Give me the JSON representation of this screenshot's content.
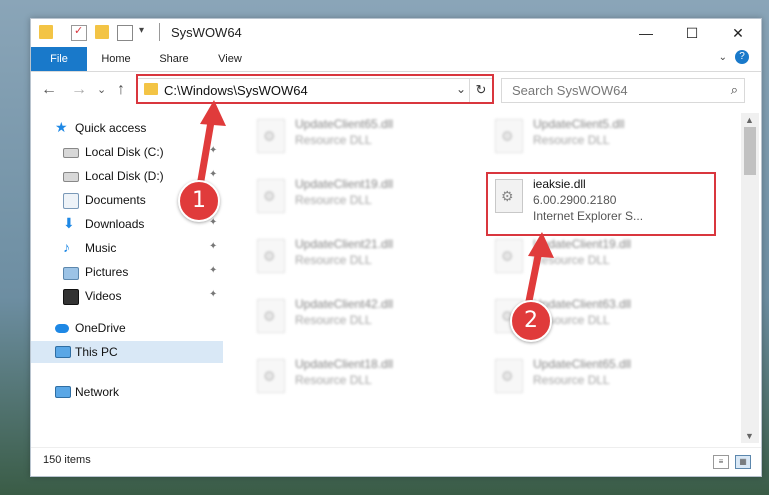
{
  "window": {
    "title": "SysWOW64",
    "minimize": "—",
    "maximize": "☐",
    "close": "✕"
  },
  "ribbon": {
    "tabs": [
      {
        "label": "File"
      },
      {
        "label": "Home"
      },
      {
        "label": "Share"
      },
      {
        "label": "View"
      }
    ],
    "collapse_glyph": "⌄",
    "help_glyph": "?"
  },
  "navigation": {
    "back_glyph": "←",
    "forward_glyph": "→",
    "recent_glyph": "⌄",
    "up_glyph": "↑",
    "address": "C:\\Windows\\SysWOW64",
    "address_dropdown_glyph": "⌄",
    "refresh_glyph": "↻",
    "search_placeholder": "Search SysWOW64",
    "search_glyph": "⌕"
  },
  "sidebar": {
    "items": [
      {
        "label": "Quick access",
        "icon": "star-icon"
      },
      {
        "label": "Local Disk (C:)",
        "icon": "drive-icon"
      },
      {
        "label": "Local Disk (D:)",
        "icon": "drive-icon"
      },
      {
        "label": "Documents",
        "icon": "documents-icon"
      },
      {
        "label": "Downloads",
        "icon": "downloads-icon"
      },
      {
        "label": "Music",
        "icon": "music-icon"
      },
      {
        "label": "Pictures",
        "icon": "pictures-icon"
      },
      {
        "label": "Videos",
        "icon": "videos-icon"
      },
      {
        "label": "OneDrive",
        "icon": "cloud-icon"
      },
      {
        "label": "This PC",
        "icon": "computer-icon"
      },
      {
        "label": "Network",
        "icon": "network-icon"
      }
    ],
    "pin_glyph": "📌"
  },
  "files": [
    {
      "name": "UpdateClient65.dll",
      "desc": "Resource DLL"
    },
    {
      "name": "UpdateClient5.dll",
      "desc": "Resource DLL"
    },
    {
      "name": "UpdateClient19.dll",
      "desc": "Resource DLL"
    },
    {
      "name": "ieaksie.dll",
      "desc": "6.00.2900.2180",
      "extra": "Internet Explorer S..."
    },
    {
      "name": "UpdateClient21.dll",
      "desc": "Resource DLL"
    },
    {
      "name": "UpdateClient19.dll",
      "desc": "Resource DLL"
    },
    {
      "name": "UpdateClient42.dll",
      "desc": "Resource DLL"
    },
    {
      "name": "UpdateClient63.dll",
      "desc": "Resource DLL"
    },
    {
      "name": "UpdateClient18.dll",
      "desc": "Resource DLL"
    },
    {
      "name": "UpdateClient65.dll",
      "desc": "Resource DLL"
    }
  ],
  "status": {
    "item_count": "150 items"
  },
  "annotations": {
    "marker_1": "1",
    "marker_2": "2"
  },
  "colors": {
    "accent": "#1979ca",
    "annotation_red": "#d9363e"
  }
}
